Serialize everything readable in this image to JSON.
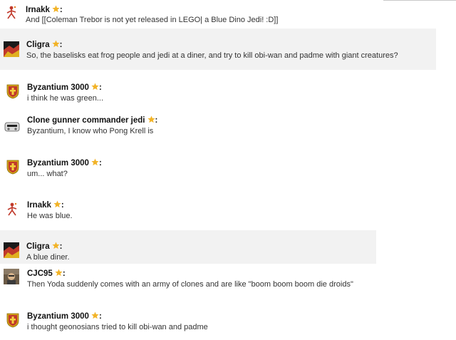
{
  "colors": {
    "highlight_bg": "#f2f2f2",
    "star": "#f2b327",
    "username": "#111111",
    "message_text": "#333333"
  },
  "messages": [
    {
      "user": "Irnakk",
      "colon": ":",
      "avatar": "irnakk-avatar-icon",
      "text": "And [[Coleman Trebor is not yet released in LEGO| a Blue Dino Jedi! :D]]",
      "highlighted": false
    },
    {
      "user": "Cligra",
      "colon": ":",
      "avatar": "cligra-avatar-icon",
      "text": "So, the baselisks eat frog people and jedi at a diner, and try to kill obi-wan and padme with giant creatures?",
      "highlighted": true
    },
    {
      "user": "Byzantium 3000",
      "colon": ":",
      "avatar": "byzantium-crest-icon",
      "text": "i think he was green...",
      "highlighted": false
    },
    {
      "user": "Clone gunner commander jedi",
      "colon": ":",
      "avatar": "clone-gunner-avatar-icon",
      "text": "Byzantium, I know who Pong Krell is",
      "highlighted": false
    },
    {
      "user": "Byzantium 3000",
      "colon": ":",
      "avatar": "byzantium-crest-icon",
      "text": "um... what?",
      "highlighted": false
    },
    {
      "user": "Irnakk",
      "colon": ":",
      "avatar": "irnakk-avatar-icon",
      "text": "He was blue.",
      "highlighted": false
    },
    {
      "user": "Cligra",
      "colon": ":",
      "avatar": "cligra-avatar-icon",
      "text": "A blue diner.",
      "highlighted": true
    },
    {
      "user": "CJC95",
      "colon": ":",
      "avatar": "cjc95-avatar-icon",
      "text": "Then Yoda suddenly comes with an army of clones and are like \"boom boom boom die droids\"",
      "highlighted": false
    },
    {
      "user": "Byzantium 3000",
      "colon": ":",
      "avatar": "byzantium-crest-icon",
      "text": "i thought geonosians tried to kill obi-wan and padme",
      "highlighted": false
    }
  ]
}
